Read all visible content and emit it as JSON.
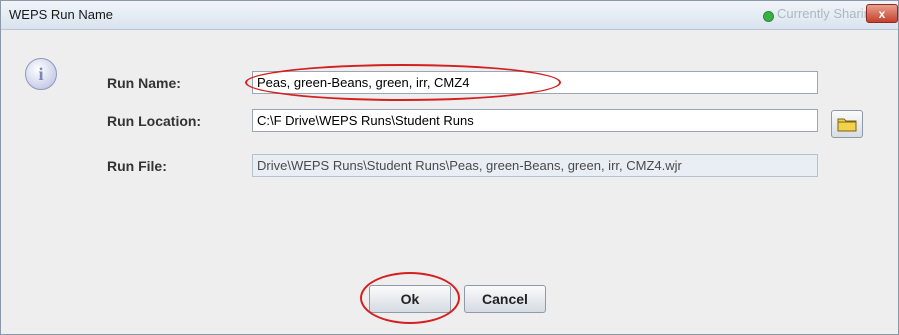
{
  "window": {
    "title": "WEPS Run Name",
    "sharing_status": "Currently Sharing",
    "close_label": "x"
  },
  "form": {
    "run_name_label": "Run Name:",
    "run_name_value": "Peas, green-Beans, green, irr, CMZ4",
    "run_location_label": "Run Location:",
    "run_location_value": "C:\\F Drive\\WEPS Runs\\Student Runs",
    "run_file_label": "Run File:",
    "run_file_value": "Drive\\WEPS Runs\\Student Runs\\Peas, green-Beans, green, irr, CMZ4.wjr"
  },
  "buttons": {
    "ok": "Ok",
    "cancel": "Cancel"
  },
  "icons": {
    "info": "info-icon",
    "folder": "folder-icon",
    "close": "close-icon"
  },
  "colors": {
    "annotation": "#d42020",
    "sharing_dot": "#3cb043",
    "close_button": "#c4402c"
  }
}
